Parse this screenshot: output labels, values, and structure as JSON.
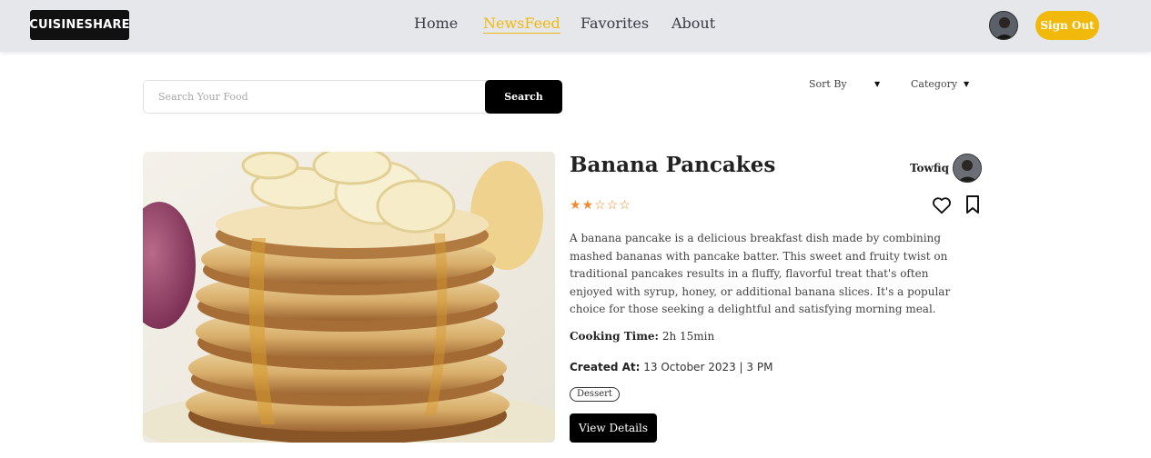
{
  "brand": {
    "logo_text": "CUISINESHARE"
  },
  "nav": {
    "items": [
      {
        "label": "Home",
        "active": false
      },
      {
        "label": "NewsFeed",
        "active": true
      },
      {
        "label": "Favorites",
        "active": false
      },
      {
        "label": "About",
        "active": false
      }
    ]
  },
  "header": {
    "signout_label": "Sign Out"
  },
  "search": {
    "placeholder": "Search Your Food",
    "value": "",
    "button_label": "Search"
  },
  "filters": {
    "sort_label": "Sort By",
    "category_label": "Category"
  },
  "post": {
    "title": "Banana Pancakes",
    "author": "Towfiq",
    "rating": 2,
    "rating_max": 5,
    "description": "A banana pancake is a delicious breakfast dish made by combining mashed bananas with pancake batter. This sweet and fruity twist on traditional pancakes results in a fluffy, flavorful treat that's often enjoyed with syrup, honey, or additional banana slices. It's a popular choice for those seeking a delightful and satisfying morning meal.",
    "cooking_time_label": "Cooking Time:",
    "cooking_time": "2h 15min",
    "created_label": "Created At:",
    "created_at": "13 October 2023 | 3 PM",
    "tag": "Dessert",
    "details_label": "View Details"
  },
  "colors": {
    "accent": "#f0b90b",
    "star": "#f08a2e",
    "header_bg": "#e6e7ea"
  }
}
